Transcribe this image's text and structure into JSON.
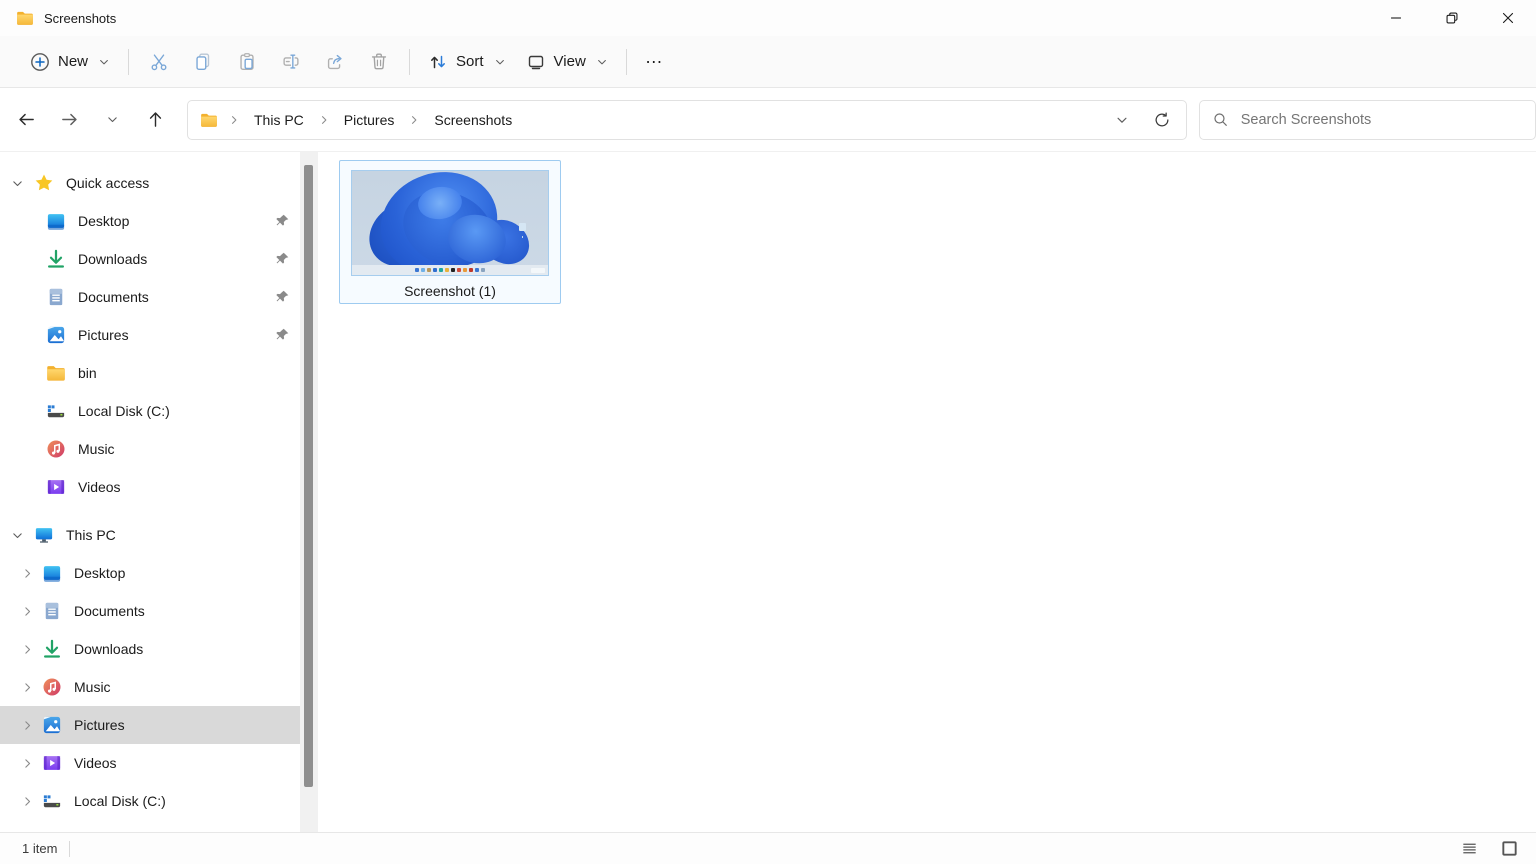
{
  "window": {
    "title": "Screenshots",
    "controls": {
      "minimize": "minimize",
      "restore": "restore-down",
      "close": "close"
    }
  },
  "toolbar": {
    "new_label": "New",
    "sort_label": "Sort",
    "view_label": "View",
    "more_label": "…",
    "icon_buttons": [
      "cut",
      "copy",
      "paste",
      "rename",
      "share",
      "delete"
    ]
  },
  "address_bar": {
    "nav_icons": [
      "back",
      "forward",
      "recent-locations",
      "up"
    ],
    "breadcrumb": {
      "items": [
        {
          "label": "This PC"
        },
        {
          "label": "Pictures"
        },
        {
          "label": "Screenshots"
        }
      ]
    },
    "address_actions": [
      "previous-locations",
      "refresh"
    ],
    "search": {
      "placeholder": "Search Screenshots",
      "value": ""
    }
  },
  "sidebar": {
    "quick_access": {
      "label": "Quick access",
      "items": [
        {
          "label": "Desktop",
          "icon": "desktop-icon",
          "pinned": true
        },
        {
          "label": "Downloads",
          "icon": "downloads-icon",
          "pinned": true
        },
        {
          "label": "Documents",
          "icon": "documents-icon",
          "pinned": true
        },
        {
          "label": "Pictures",
          "icon": "pictures-icon",
          "pinned": true
        },
        {
          "label": "bin",
          "icon": "folder-icon",
          "pinned": false
        },
        {
          "label": "Local Disk (C:)",
          "icon": "disk-icon",
          "pinned": false
        },
        {
          "label": "Music",
          "icon": "music-icon",
          "pinned": false
        },
        {
          "label": "Videos",
          "icon": "videos-icon",
          "pinned": false
        }
      ]
    },
    "this_pc": {
      "label": "This PC",
      "items": [
        {
          "label": "Desktop",
          "icon": "desktop-icon",
          "selected": false
        },
        {
          "label": "Documents",
          "icon": "documents-icon",
          "selected": false
        },
        {
          "label": "Downloads",
          "icon": "downloads-icon",
          "selected": false
        },
        {
          "label": "Music",
          "icon": "music-icon",
          "selected": false
        },
        {
          "label": "Pictures",
          "icon": "pictures-icon",
          "selected": true
        },
        {
          "label": "Videos",
          "icon": "videos-icon",
          "selected": false
        },
        {
          "label": "Local Disk (C:)",
          "icon": "disk-icon",
          "selected": false
        }
      ]
    }
  },
  "content": {
    "file": {
      "name": "Screenshot (1)",
      "selected": true,
      "thumbnail_description": "Windows 11 bloom desktop wallpaper with taskbar",
      "thumbnail_taskbar_colors": [
        "#3a76d2",
        "#6fb1e8",
        "#b9995a",
        "#2f6fd0",
        "#1fa8a0",
        "#e8b23a",
        "#222222",
        "#d04a3a",
        "#e89a3a",
        "#c0392b",
        "#3a76d2",
        "#8aa4c0"
      ]
    }
  },
  "status_bar": {
    "items_count": "1 item",
    "view_toggles": [
      "details-view",
      "large-thumbnails-view"
    ]
  },
  "colors": {
    "accent": "#0067c0",
    "selection_border": "#9ecbf0",
    "sidebar_selected_bg": "#d9d9d9",
    "toolbar_icon_blue": "#7aa7d7",
    "toolbar_icon_gray": "#a3a3a3"
  }
}
